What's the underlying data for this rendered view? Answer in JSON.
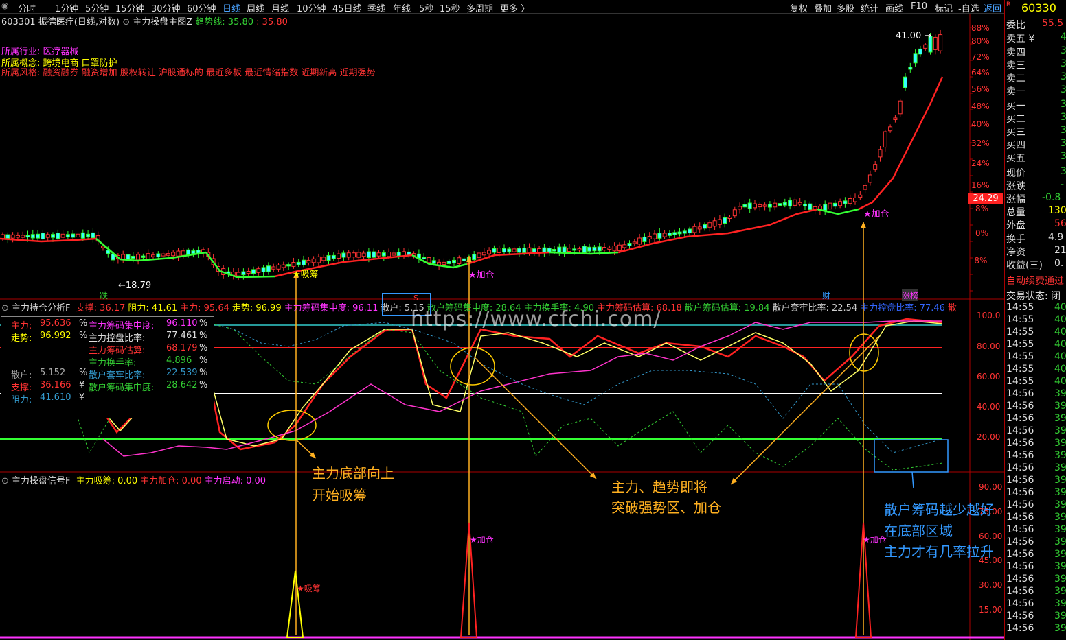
{
  "toolbar": {
    "periods": [
      "分时",
      "1分钟",
      "5分钟",
      "15分钟",
      "30分钟",
      "60分钟",
      "日线",
      "周线",
      "月线",
      "10分钟",
      "45日线",
      "季线",
      "年线",
      "5秒",
      "15秒",
      "多周期",
      "更多 〉"
    ],
    "active_period": "日线",
    "right_buttons": [
      "复权",
      "叠加",
      "多股",
      "统计",
      "画线",
      "F10",
      "标记",
      "-自选",
      "返回"
    ]
  },
  "title": {
    "stock": "603301 振德医疗(日线,对数)",
    "indicator": "主力操盘主图Z",
    "trend_label": "趋势线:",
    "trend_value1": "35.80",
    "trend_value2": "35.80"
  },
  "info": {
    "industry_label": "所属行业:",
    "industry": "医疗器械",
    "concept_label": "所属概念:",
    "concept": "跨境电商 口罩防护",
    "style_label": "所属风格:",
    "style": "融资融券 融资增加 股权转让 沪股通标的 最近多板 最近情绪指数 近期新高 近期强势"
  },
  "main_labels": {
    "high": "41.00",
    "low": "18.79",
    "xichou": "★吸筹",
    "jiacang1": "★加仓",
    "jiacang2": "★加仓",
    "die": "跌",
    "s_mark": "S",
    "cai": "财",
    "zhangting": "涨榜",
    "price_tag": "24.29"
  },
  "price_axis": [
    "88%",
    "80%",
    "72%",
    "64%",
    "56%",
    "48%",
    "40%",
    "32%",
    "24%",
    "16%",
    "8%",
    "0%",
    "-8%"
  ],
  "panel2": {
    "title": "主力持仓分析F",
    "items": [
      {
        "label": "支撑:",
        "value": "36.17",
        "color": "#ff3333"
      },
      {
        "label": "阻力:",
        "value": "41.61",
        "color": "#ffff00"
      },
      {
        "label": "主力:",
        "value": "95.64",
        "color": "#ff3333"
      },
      {
        "label": "走势:",
        "value": "96.99",
        "color": "#ffff00"
      },
      {
        "label": "主力筹码集中度:",
        "value": "96.11",
        "color": "#ff33ff"
      },
      {
        "label": "散户:",
        "value": "5.15",
        "color": "#cccccc"
      },
      {
        "label": "散户筹码集中度:",
        "value": "28.64",
        "color": "#33cc33"
      },
      {
        "label": "主力换手率:",
        "value": "4.90",
        "color": "#33cc33"
      },
      {
        "label": "主力筹码估算:",
        "value": "68.18",
        "color": "#ff3333"
      },
      {
        "label": "散户筹码估算:",
        "value": "19.84",
        "color": "#33cc33"
      },
      {
        "label": "散户套牢比率:",
        "value": "22.54",
        "color": "#cccccc"
      },
      {
        "label": "主力控盘比率:",
        "value": "77.46",
        "color": "#3366ff"
      },
      {
        "label": "散",
        "value": "",
        "color": "#ff3333"
      }
    ],
    "axis": [
      "100.0",
      "80.00",
      "60.00",
      "40.00",
      "20.00"
    ]
  },
  "legend": {
    "rows": [
      {
        "l": "主力:",
        "lv": "95.636",
        "lu": "%",
        "r": "主力筹码集中度:",
        "rv": "96.110",
        "ru": "%",
        "lc": "#ff3333",
        "rc": "#ff33ff"
      },
      {
        "l": "走势:",
        "lv": "96.992",
        "lu": "%",
        "r": "主力控盘比率:",
        "rv": "77.461",
        "ru": "%",
        "lc": "#ffff00",
        "rc": "#dddddd"
      },
      {
        "l": "",
        "lv": "",
        "lu": "",
        "r": "主力筹码估算:",
        "rv": "68.179",
        "ru": "%",
        "lc": "#ffffff",
        "rc": "#ff3333"
      },
      {
        "l": "",
        "lv": "",
        "lu": "",
        "r": "主力换手率:",
        "rv": "4.896",
        "ru": "%",
        "lc": "#ffffff",
        "rc": "#33cc33"
      },
      {
        "l": "散户:",
        "lv": "5.152",
        "lu": "%",
        "r": "散户套牢比率:",
        "rv": "22.539",
        "ru": "%",
        "lc": "#aaaaaa",
        "rc": "#3399cc"
      },
      {
        "l": "支撑:",
        "lv": "36.166",
        "lu": "¥",
        "r": "散户筹码集中度:",
        "rv": "28.642",
        "ru": "%",
        "lc": "#ff3333",
        "rc": "#33cc33"
      },
      {
        "l": "阻力:",
        "lv": "41.610",
        "lu": "¥",
        "r": "",
        "rv": "",
        "ru": "",
        "lc": "#3399cc",
        "rc": "#ffffff"
      }
    ]
  },
  "panel3": {
    "title": "主力操盘信号F",
    "items": [
      {
        "label": "主力吸筹:",
        "value": "0.00",
        "color": "#ffff00"
      },
      {
        "label": "主力加仓:",
        "value": "0.00",
        "color": "#ff3333"
      },
      {
        "label": "主力启动:",
        "value": "0.00",
        "color": "#ff33ff"
      }
    ],
    "axis": [
      "90.00",
      "75.00",
      "60.00",
      "45.00",
      "30.00",
      "15.00"
    ],
    "sig_xichou": "★吸筹",
    "sig_jiacang1": "★加仓",
    "sig_jiacang2": "★加仓"
  },
  "watermark": "https://www.cfchi.com/",
  "annotations": {
    "a1_line1": "主力底部向上",
    "a1_line2": "开始吸筹",
    "a2_line1": "主力、趋势即将",
    "a2_line2": "突破强势区、加仓",
    "a3_line1": "散户筹码越少越好",
    "a3_line2": "在底部区域",
    "a3_line3": "主力才有几率拉升"
  },
  "right_panel": {
    "code": "60330",
    "rows": [
      {
        "label": "委比",
        "value": "55.5",
        "vc": "#ff3333"
      },
      {
        "label": "卖五 ¥",
        "value": "4",
        "vc": "#33cc33"
      },
      {
        "label": "卖四",
        "value": "3",
        "vc": "#33cc33"
      },
      {
        "label": "卖三",
        "value": "3",
        "vc": "#33cc33"
      },
      {
        "label": "卖二",
        "value": "3",
        "vc": "#33cc33"
      },
      {
        "label": "卖一",
        "value": "3",
        "vc": "#33cc33"
      },
      {
        "label": "买一",
        "value": "3",
        "vc": "#33cc33"
      },
      {
        "label": "买二",
        "value": "3",
        "vc": "#33cc33"
      },
      {
        "label": "买三",
        "value": "3",
        "vc": "#33cc33"
      },
      {
        "label": "买四",
        "value": "3",
        "vc": "#33cc33"
      },
      {
        "label": "买五",
        "value": "3",
        "vc": "#33cc33"
      },
      {
        "label": "现价",
        "value": "3",
        "vc": "#33cc33"
      },
      {
        "label": "涨跌",
        "value": "-",
        "vc": "#33cc33"
      },
      {
        "label": "涨幅",
        "value": "-0.8",
        "vc": "#33cc33"
      },
      {
        "label": "总量",
        "value": "130",
        "vc": "#ffff00"
      },
      {
        "label": "外盘",
        "value": "56",
        "vc": "#ff3333"
      },
      {
        "label": "换手",
        "value": "4.9",
        "vc": "#dddddd"
      },
      {
        "label": "净资",
        "value": "21",
        "vc": "#dddddd"
      },
      {
        "label": "收益(三)",
        "value": "0.",
        "vc": "#dddddd"
      }
    ],
    "auto_renew": "自动续费通过",
    "status": "交易状态: 闭",
    "ticks_time": "14:55",
    "ticks": [
      {
        "t": "14:55",
        "v": "40"
      },
      {
        "t": "14:55",
        "v": "40"
      },
      {
        "t": "14:55",
        "v": "40"
      },
      {
        "t": "14:55",
        "v": "40"
      },
      {
        "t": "14:55",
        "v": "40"
      },
      {
        "t": "14:55",
        "v": "40"
      },
      {
        "t": "14:55",
        "v": "40"
      },
      {
        "t": "14:56",
        "v": "39"
      },
      {
        "t": "14:56",
        "v": "39"
      },
      {
        "t": "14:56",
        "v": "39"
      },
      {
        "t": "14:56",
        "v": "39"
      },
      {
        "t": "14:56",
        "v": "39"
      },
      {
        "t": "14:56",
        "v": "39"
      },
      {
        "t": "14:56",
        "v": "39"
      },
      {
        "t": "14:56",
        "v": "39"
      },
      {
        "t": "14:56",
        "v": "39"
      },
      {
        "t": "14:56",
        "v": "39"
      },
      {
        "t": "14:56",
        "v": "39"
      },
      {
        "t": "14:56",
        "v": "39"
      },
      {
        "t": "14:56",
        "v": "39"
      },
      {
        "t": "14:56",
        "v": "39"
      },
      {
        "t": "14:56",
        "v": "39"
      },
      {
        "t": "14:56",
        "v": "39"
      },
      {
        "t": "14:56",
        "v": "39"
      },
      {
        "t": "14:56",
        "v": "39"
      },
      {
        "t": "14:56",
        "v": "39"
      },
      {
        "t": "14:56",
        "v": "39"
      }
    ]
  },
  "colors": {
    "up": "#ff3333",
    "down": "#33cc33",
    "yellow": "#ffff00",
    "magenta": "#ff33ff",
    "orange": "#ffb020",
    "blue": "#3399ff"
  }
}
